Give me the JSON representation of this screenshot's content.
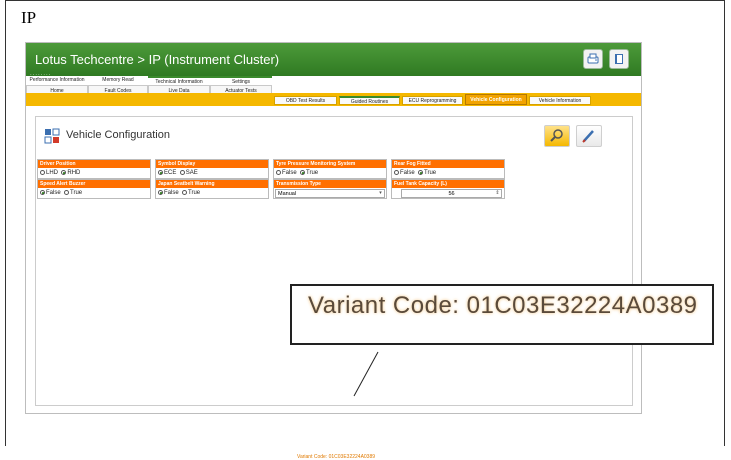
{
  "doc_title": "IP",
  "app": {
    "title": "Lotus Techcentre > IP (Instrument Cluster)",
    "title_dots": "........",
    "buttons": [
      {
        "name": "print",
        "icon": "print-icon"
      },
      {
        "name": "help",
        "icon": "book-icon"
      }
    ]
  },
  "tabs": {
    "row1": [
      "Performance Information",
      "Memory Read",
      "Technical Information",
      "Settings"
    ],
    "row2": [
      "Home",
      "Fault Codes",
      "Live Data",
      "Actuator Tests",
      "OBD Test Results",
      "Guided Routines",
      "ECU Reprogramming",
      "Vehicle Configuration",
      "Vehicle Information"
    ],
    "active": "Vehicle Configuration"
  },
  "page": {
    "title": "Vehicle Configuration",
    "icon": "configuration-icon",
    "action_buttons": [
      {
        "name": "search",
        "icon": "magnifier-icon"
      },
      {
        "name": "write",
        "icon": "pen-icon"
      }
    ]
  },
  "fields": {
    "driver_position": {
      "label": "Driver Position",
      "opt1": "LHD",
      "opt2": "RHD",
      "selected": "RHD"
    },
    "symbol_display": {
      "label": "Symbol Display",
      "opt1": "ECE",
      "opt2": "SAE",
      "selected": "ECE"
    },
    "tpms": {
      "label": "Tyre Pressure Monitoring System",
      "opt1": "False",
      "opt2": "True",
      "selected": "True"
    },
    "rear_fog": {
      "label": "Rear Fog Fitted",
      "opt1": "False",
      "opt2": "True",
      "selected": "True"
    },
    "speed_alert": {
      "label": "Speed Alert Buzzer",
      "opt1": "False",
      "opt2": "True",
      "selected": "False"
    },
    "japan_seatbelt": {
      "label": "Japan Seatbelt Warning",
      "opt1": "False",
      "opt2": "True",
      "selected": "False"
    },
    "transmission": {
      "label": "Transmission Type",
      "value": "Manual"
    },
    "fuel_tank": {
      "label": "Fuel Tank Capacity (L)",
      "value": "56"
    }
  },
  "variant_code_small": "Variant Code: 01C03E32224A0389",
  "variant_code_zoom": "Variant Code: 01C03E32224A0389",
  "colors": {
    "title_green": "#3a8a2c",
    "orange": "#ff6f00",
    "tab_yellow": "#f5b800"
  }
}
